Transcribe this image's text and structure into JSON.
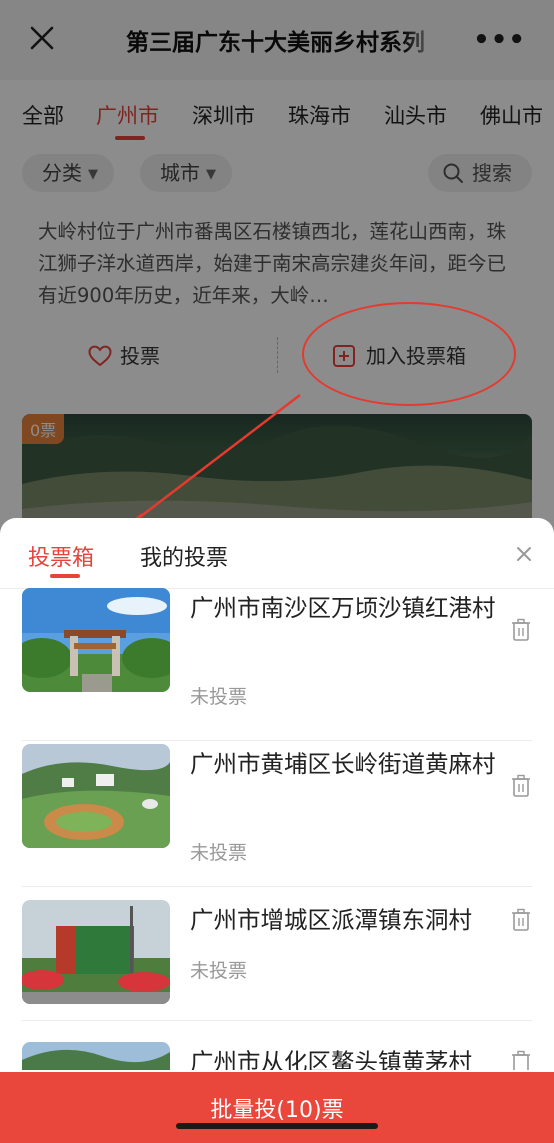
{
  "header": {
    "title": "第三届广东十大美丽乡村系列",
    "close_icon": "close-icon",
    "more_icon": "more-dots-icon"
  },
  "city_tabs": [
    "全部",
    "广州市",
    "深圳市",
    "珠海市",
    "汕头市",
    "佛山市"
  ],
  "active_city_tab": "广州市",
  "filters": {
    "category": "分类",
    "city": "城市",
    "search": "搜索"
  },
  "card": {
    "description": "大岭村位于广州市番禺区石楼镇西北，莲花山西南，珠江狮子洋水道西岸，始建于南宋高宗建炎年间，距今已有近900年历史，近年来，大岭…",
    "vote_label": "投票",
    "add_label": "加入投票箱"
  },
  "card2": {
    "badge": "0票"
  },
  "sheet": {
    "tabs": [
      "投票箱",
      "我的投票"
    ],
    "active_tab": "投票箱",
    "items": [
      {
        "name": "广州市南沙区万顷沙镇红港村",
        "status": "未投票"
      },
      {
        "name": "广州市黄埔区长岭街道黄麻村",
        "status": "未投票"
      },
      {
        "name": "广州市增城区派潭镇东洞村",
        "status": "未投票"
      },
      {
        "name": "广州市从化区鳌头镇黄茅村",
        "status": ""
      }
    ],
    "batch_button": "批量投(10)票"
  },
  "colors": {
    "accent": "#e8433b",
    "annotation": "#e53a2f",
    "badge": "#e9833b"
  }
}
